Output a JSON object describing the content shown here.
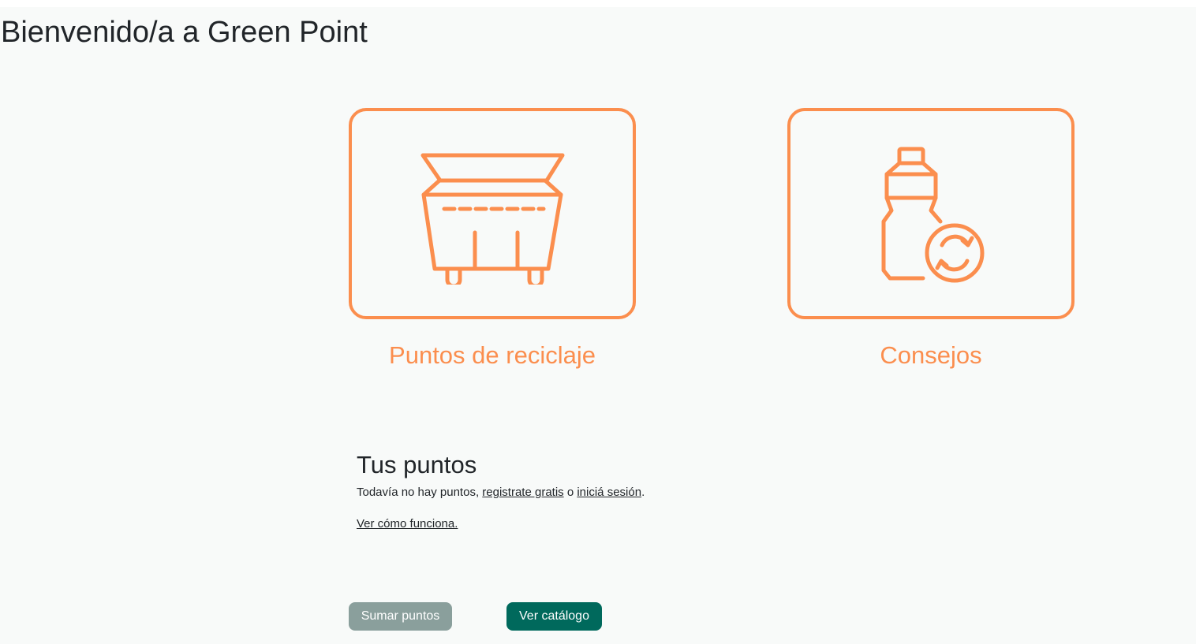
{
  "header": {
    "title": "Bienvenido/a a Green Point"
  },
  "cards": [
    {
      "label": "Puntos de reciclaje",
      "icon": "recycling-bin-icon"
    },
    {
      "label": "Consejos",
      "icon": "bottle-recycle-icon"
    }
  ],
  "points": {
    "title": "Tus puntos",
    "text_before": "Todavía no hay puntos, ",
    "register_link": "registrate gratis",
    "text_middle": " o ",
    "login_link": "iniciá sesión",
    "text_end": ".",
    "how_link": "Ver cómo funciona."
  },
  "buttons": {
    "add_points": "Sumar puntos",
    "catalog": "Ver catálogo"
  },
  "colors": {
    "accent": "#fb8e4e",
    "primary": "#00695c",
    "disabled": "#8a9f9c",
    "background": "#f8faf9"
  }
}
